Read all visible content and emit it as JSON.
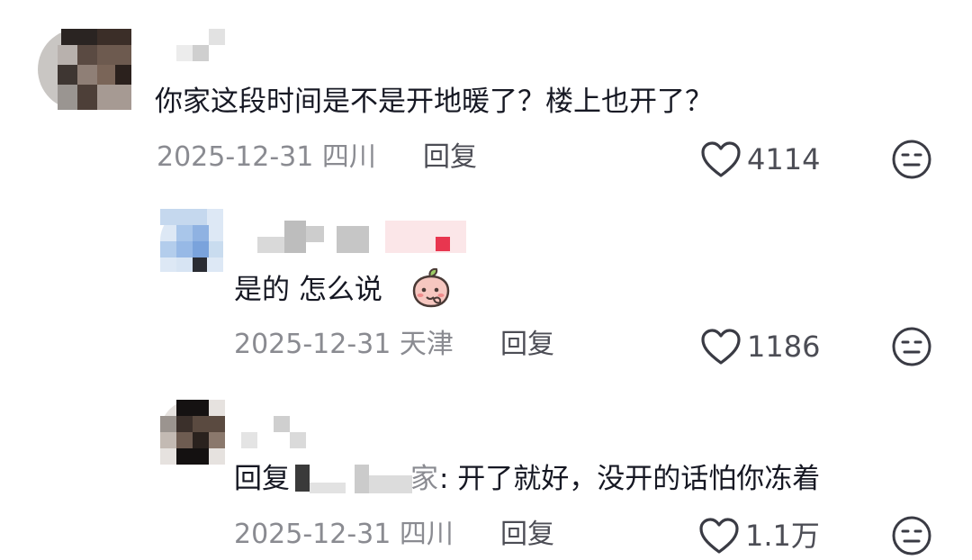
{
  "comments": [
    {
      "text": "你家这段时间是不是开地暖了？楼上也开了？",
      "date": "2025-12-31",
      "location": "四川",
      "reply_label": "回复",
      "likes": "4114"
    },
    {
      "text": "是的 怎么说",
      "emoji": "peach-emoji",
      "date": "2025-12-31",
      "location": "天津",
      "reply_label": "回复",
      "likes": "1186"
    },
    {
      "reply_prefix": "回复",
      "reply_target_visible": "家",
      "text": ": 开了就好，没开的话怕你冻着",
      "date": "2025-12-31",
      "location": "四川",
      "reply_label": "回复",
      "likes": "1.1万"
    }
  ],
  "icons": {
    "like": "heart-outline-icon",
    "dislike": "neutral-face-icon"
  }
}
